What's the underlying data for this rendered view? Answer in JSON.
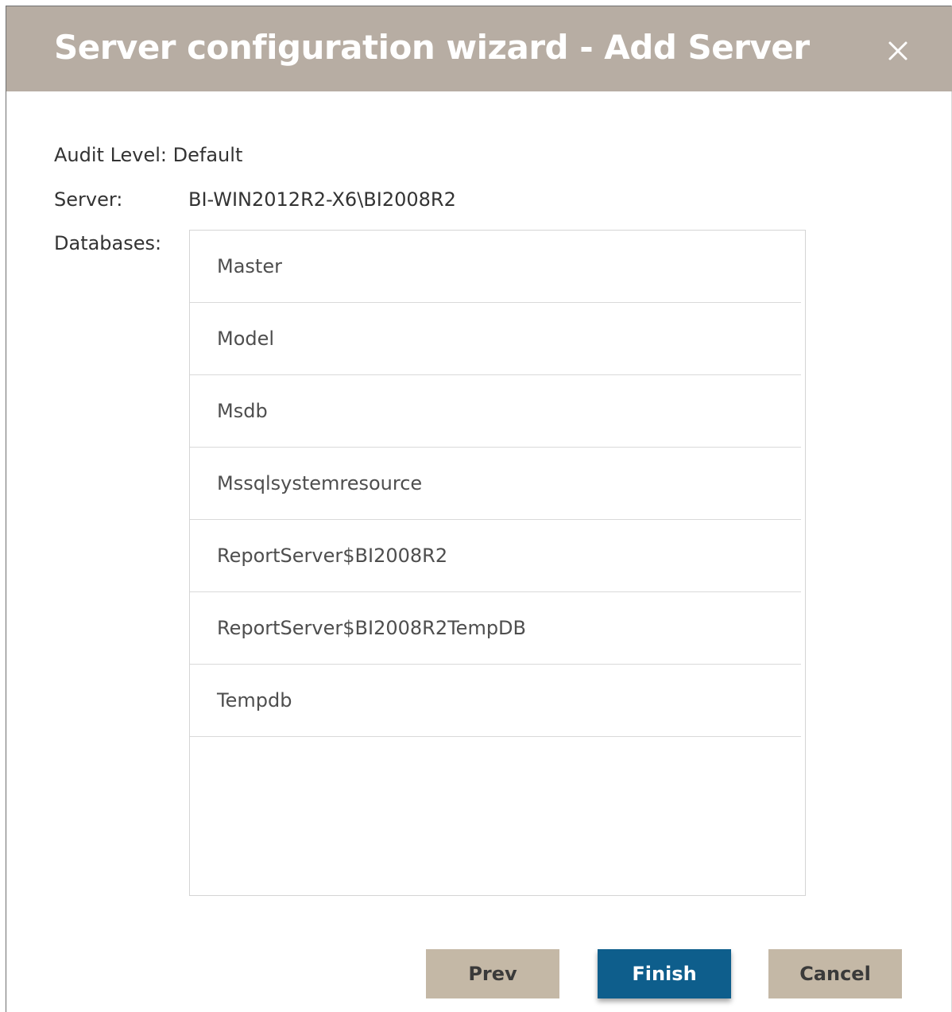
{
  "dialog": {
    "title": "Server configuration wizard - Add Server",
    "close_icon": "close-icon"
  },
  "fields": {
    "audit_level_label": "Audit Level:",
    "audit_level_value": "Default",
    "server_label": "Server:",
    "server_value": "BI-WIN2012R2-X6\\BI2008R2",
    "databases_label": "Databases:"
  },
  "databases": [
    "Master",
    "Model",
    "Msdb",
    "Mssqlsystemresource",
    "ReportServer$BI2008R2",
    "ReportServer$BI2008R2TempDB",
    "Tempdb"
  ],
  "buttons": {
    "prev": "Prev",
    "finish": "Finish",
    "cancel": "Cancel"
  },
  "colors": {
    "titlebar": "#b7ada3",
    "finish_button": "#0e5e8c",
    "secondary_button": "#c4b8a6"
  }
}
